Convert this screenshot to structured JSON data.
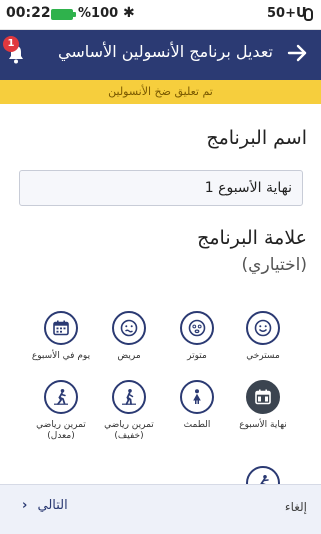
{
  "status_bar": {
    "time": "00:22",
    "battery_percent": "%100",
    "insulin_units": "50+U"
  },
  "header": {
    "title": "تعديل برنامج الأنسولين الأساسي",
    "notification_count": "1"
  },
  "alert": {
    "text": "تم تعليق ضخ الأنسولين"
  },
  "program_name": {
    "title": "اسم البرنامج",
    "value": "نهاية الأسبوع 1"
  },
  "program_tag": {
    "title": "علامة البرنامج",
    "subtitle": "(اختياري)",
    "tags": [
      {
        "label": "مسترخي",
        "icon": "smile-face-icon",
        "selected": false
      },
      {
        "label": "متوتر",
        "icon": "stressed-face-icon",
        "selected": false
      },
      {
        "label": "مريض",
        "icon": "sick-face-icon",
        "selected": false
      },
      {
        "label": "يوم في الأسبوع",
        "icon": "calendar-icon",
        "selected": false
      },
      {
        "label": "نهاية الأسبوع",
        "icon": "weekend-calendar-icon",
        "selected": true
      },
      {
        "label": "الطمث",
        "icon": "female-icon",
        "selected": false
      },
      {
        "label": "تمرين رياضي (خفيف)",
        "icon": "walking-icon",
        "selected": false
      },
      {
        "label": "تمرين رياضي (معدل)",
        "icon": "exercise-icon",
        "selected": false
      },
      {
        "label": "",
        "icon": "running-icon",
        "selected": false
      }
    ]
  },
  "footer": {
    "next_label": "التالي",
    "cancel_label": "إلغاء"
  },
  "colors": {
    "header": "#2b3a73",
    "alert": "#f6ce3d",
    "badge": "#e0383e",
    "battery": "#2fb24c"
  }
}
